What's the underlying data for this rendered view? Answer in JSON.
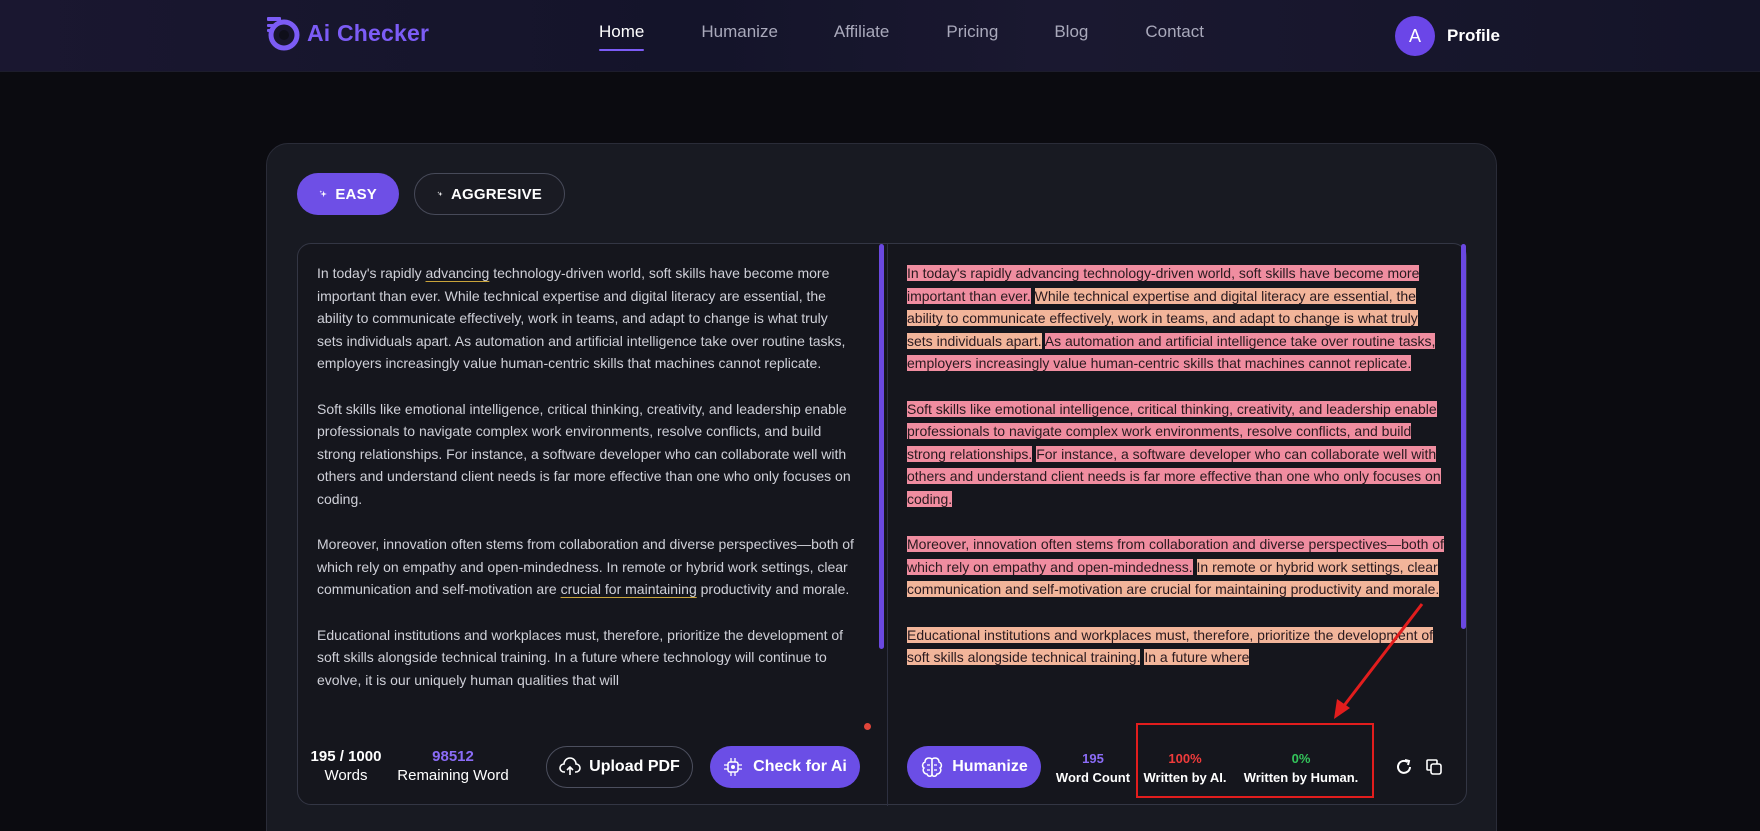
{
  "brand": {
    "name": "Ai Checker",
    "accent": "#7c5cf6"
  },
  "nav": {
    "items": [
      {
        "label": "Home",
        "active": true
      },
      {
        "label": "Humanize",
        "active": false
      },
      {
        "label": "Affiliate",
        "active": false
      },
      {
        "label": "Pricing",
        "active": false
      },
      {
        "label": "Blog",
        "active": false
      },
      {
        "label": "Contact",
        "active": false
      }
    ]
  },
  "profile": {
    "initial": "A",
    "label": "Profile"
  },
  "modes": {
    "easy": "EASY",
    "aggressive": "AGGRESIVE",
    "selected": "EASY"
  },
  "input": {
    "paragraphs": [
      [
        "In today's rapidly ",
        "advancing",
        " technology-driven world, soft skills have become more important than ever. While technical expertise and digital literacy are essential, the ability to communicate effectively, work in teams, and adapt to change is what truly sets individuals apart. As automation and artificial intelligence take over routine tasks, employers increasingly value human-centric skills that machines cannot replicate."
      ],
      [
        "Soft skills like emotional intelligence, critical thinking, creativity, and leadership enable professionals to navigate complex work environments, resolve conflicts, and build strong relationships. For instance, a software developer who can collaborate well with others and understand client needs is far more effective than one who only focuses on coding."
      ],
      [
        "Moreover, innovation often stems from collaboration and diverse perspectives—both of which rely on empathy and open-mindedness. In remote or hybrid work settings, clear communication and self-motivation are ",
        "crucial for maintaining",
        " productivity and morale."
      ],
      [
        "Educational institutions and workplaces must, therefore, prioritize the development of soft skills alongside technical training. In a future where technology will continue to evolve, it is our uniquely human qualities that will"
      ]
    ]
  },
  "output": {
    "paragraphs": [
      [
        {
          "text": "In today's rapidly advancing technology-driven world, soft skills have become more important than ever.",
          "hl": "pink"
        },
        {
          "text": " ",
          "hl": "none"
        },
        {
          "text": "While technical expertise and digital literacy are essential, the ability to communicate effectively, work in teams, and adapt to change is what truly sets individuals apart.",
          "hl": "peach"
        },
        {
          "text": " ",
          "hl": "none"
        },
        {
          "text": "As automation and artificial intelligence take over routine tasks, employers increasingly value human-centric skills that machines cannot replicate.",
          "hl": "pink"
        }
      ],
      [
        {
          "text": "Soft skills like emotional intelligence, critical thinking, creativity, and leadership enable professionals to navigate complex work environments, resolve conflicts, and build strong relationships.",
          "hl": "pink"
        },
        {
          "text": " ",
          "hl": "none"
        },
        {
          "text": "For instance, a software developer who can collaborate well with others and understand client needs is far more effective than one who only focuses on coding.",
          "hl": "pink"
        }
      ],
      [
        {
          "text": "Moreover, innovation often stems from collaboration and diverse perspectives—both of which rely on empathy and open-mindedness.",
          "hl": "pink"
        },
        {
          "text": " ",
          "hl": "none"
        },
        {
          "text": "In remote or hybrid work settings, clear communication and self-motivation are crucial for maintaining productivity and morale.",
          "hl": "peach"
        }
      ],
      [
        {
          "text": "Educational institutions and workplaces must, therefore, prioritize the development of soft skills alongside technical training.",
          "hl": "peach"
        },
        {
          "text": " ",
          "hl": "none"
        },
        {
          "text": "In a future where",
          "hl": "peach"
        }
      ]
    ]
  },
  "stats": {
    "words_count": "195 / 1000",
    "words_label": "Words",
    "remaining_count": "98512",
    "remaining_label": "Remaining Word"
  },
  "buttons": {
    "upload": "Upload PDF",
    "check": "Check for Ai",
    "humanize": "Humanize"
  },
  "result": {
    "word_count": "195",
    "word_count_label": "Word Count",
    "ai_percent": "100%",
    "ai_label": "Written by AI.",
    "human_percent": "0%",
    "human_label": "Written by Human."
  },
  "colors": {
    "highlight_pink": "#f08da0",
    "highlight_peach": "#f2b59a",
    "ai_red": "#ef3b3b",
    "human_green": "#33c45a",
    "annotation_red": "#e21d1d"
  }
}
